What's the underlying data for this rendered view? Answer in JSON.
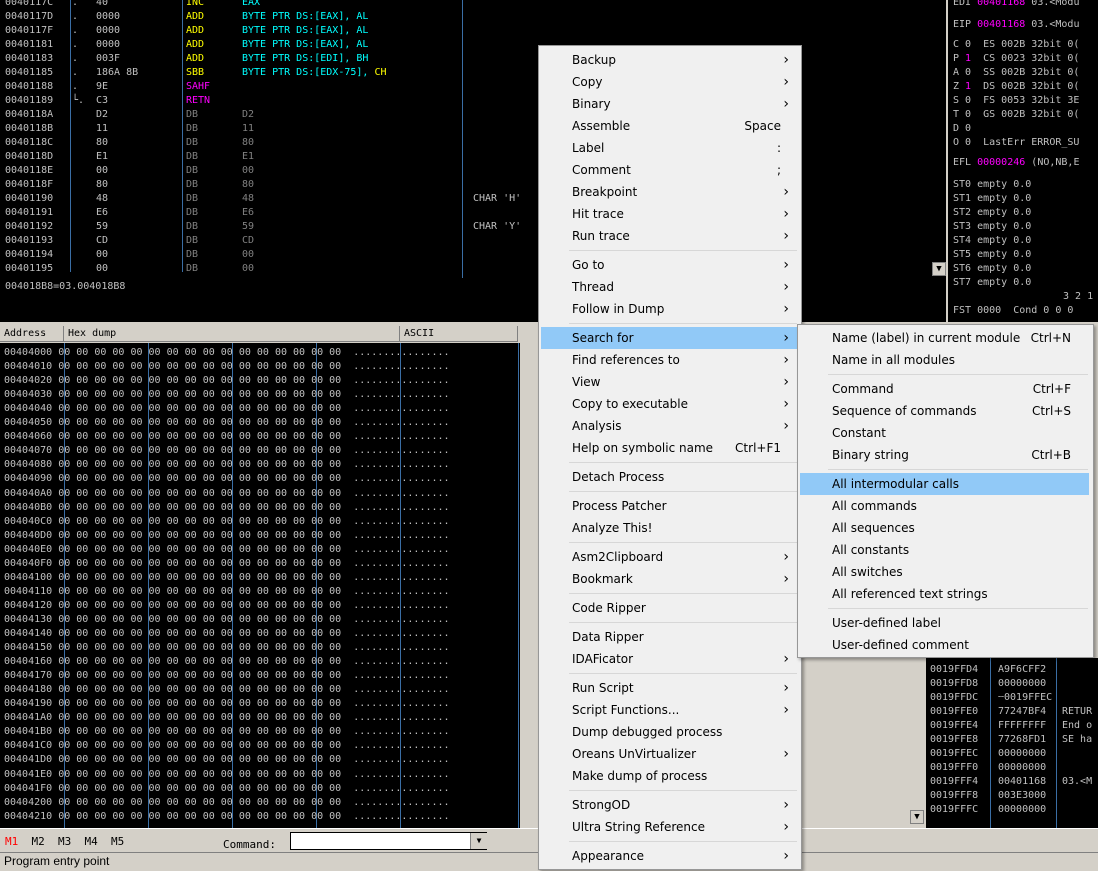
{
  "disasm": {
    "rows": [
      {
        "addr": "0040117C",
        "mark": ".",
        "bytes": "40",
        "mn": "INC",
        "op": "EAX",
        "op2": "",
        "comment": ""
      },
      {
        "addr": "0040117D",
        "mark": ".",
        "bytes": "0000",
        "mn": "ADD",
        "op": "BYTE PTR DS:[EAX], AL",
        "op2": "",
        "comment": ""
      },
      {
        "addr": "0040117F",
        "mark": ".",
        "bytes": "0000",
        "mn": "ADD",
        "op": "BYTE PTR DS:[EAX], AL",
        "op2": "",
        "comment": ""
      },
      {
        "addr": "00401181",
        "mark": ".",
        "bytes": "0000",
        "mn": "ADD",
        "op": "BYTE PTR DS:[EAX], AL",
        "op2": "",
        "comment": ""
      },
      {
        "addr": "00401183",
        "mark": ".",
        "bytes": "003F",
        "mn": "ADD",
        "op": "BYTE PTR DS:[EDI], BH",
        "op2": "",
        "comment": ""
      },
      {
        "addr": "00401185",
        "mark": ".",
        "bytes": "186A 8B",
        "mn": "SBB",
        "op": "BYTE PTR DS:[EDX-75], ",
        "op2": "CH",
        "comment": ""
      },
      {
        "addr": "00401188",
        "mark": ".",
        "bytes": "9E",
        "mn": "SAHF",
        "op": "",
        "op2": "",
        "comment": ""
      },
      {
        "addr": "00401189",
        "mark": "└.",
        "bytes": "C3",
        "mn": "RETN",
        "op": "",
        "op2": "",
        "comment": ""
      },
      {
        "addr": "0040118A",
        "mark": "",
        "bytes": "D2",
        "mn": "DB",
        "op": "D2",
        "op2": "",
        "comment": ""
      },
      {
        "addr": "0040118B",
        "mark": "",
        "bytes": "11",
        "mn": "DB",
        "op": "11",
        "op2": "",
        "comment": ""
      },
      {
        "addr": "0040118C",
        "mark": "",
        "bytes": "80",
        "mn": "DB",
        "op": "80",
        "op2": "",
        "comment": ""
      },
      {
        "addr": "0040118D",
        "mark": "",
        "bytes": "E1",
        "mn": "DB",
        "op": "E1",
        "op2": "",
        "comment": ""
      },
      {
        "addr": "0040118E",
        "mark": "",
        "bytes": "00",
        "mn": "DB",
        "op": "00",
        "op2": "",
        "comment": ""
      },
      {
        "addr": "0040118F",
        "mark": "",
        "bytes": "80",
        "mn": "DB",
        "op": "80",
        "op2": "",
        "comment": ""
      },
      {
        "addr": "00401190",
        "mark": "",
        "bytes": "48",
        "mn": "DB",
        "op": "48",
        "op2": "",
        "comment": "CHAR 'H'"
      },
      {
        "addr": "00401191",
        "mark": "",
        "bytes": "E6",
        "mn": "DB",
        "op": "E6",
        "op2": "",
        "comment": ""
      },
      {
        "addr": "00401192",
        "mark": "",
        "bytes": "59",
        "mn": "DB",
        "op": "59",
        "op2": "",
        "comment": "CHAR 'Y'"
      },
      {
        "addr": "00401193",
        "mark": "",
        "bytes": "CD",
        "mn": "DB",
        "op": "CD",
        "op2": "",
        "comment": ""
      },
      {
        "addr": "00401194",
        "mark": "",
        "bytes": "00",
        "mn": "DB",
        "op": "00",
        "op2": "",
        "comment": ""
      },
      {
        "addr": "00401195",
        "mark": "",
        "bytes": "00",
        "mn": "DB",
        "op": "00",
        "op2": "",
        "comment": ""
      }
    ],
    "info_line": "004018B8=03.004018B8"
  },
  "registers": {
    "rows": [
      {
        "name": "EDI",
        "value": "00401168",
        "info": "03.<Modu"
      },
      {
        "name": "EIP",
        "value": "00401168",
        "info": "03.<Modu"
      }
    ],
    "flags": [
      "C 0  ES 002B 32bit 0(",
      "P 1  CS 0023 32bit 0(",
      "A 0  SS 002B 32bit 0(",
      "Z 1  DS 002B 32bit 0(",
      "S 0  FS 0053 32bit 3E",
      "T 0  GS 002B 32bit 0(",
      "D 0",
      "O 0  LastErr ERROR_SU"
    ],
    "efl": {
      "name": "EFL",
      "value": "00000246",
      "info": "(NO,NB,E"
    },
    "fpu": [
      "ST0 empty 0.0",
      "ST1 empty 0.0",
      "ST2 empty 0.0",
      "ST3 empty 0.0",
      "ST4 empty 0.0",
      "ST5 empty 0.0",
      "ST6 empty 0.0",
      "ST7 empty 0.0"
    ],
    "fpu_bits": "3 2 1",
    "fst": "FST 0000  Cond 0 0 0"
  },
  "dump": {
    "header_address": "Address",
    "header_hex": "Hex dump",
    "header_ascii": "ASCII",
    "hex": "00 00 00 00 00 00 00 00 00 00 00 00 00 00 00 00",
    "ascii": "................",
    "addresses": [
      "00404000",
      "00404010",
      "00404020",
      "00404030",
      "00404040",
      "00404050",
      "00404060",
      "00404070",
      "00404080",
      "00404090",
      "004040A0",
      "004040B0",
      "004040C0",
      "004040D0",
      "004040E0",
      "004040F0",
      "00404100",
      "00404110",
      "00404120",
      "00404130",
      "00404140",
      "00404150",
      "00404160",
      "00404170",
      "00404180",
      "00404190",
      "004041A0",
      "004041B0",
      "004041C0",
      "004041D0",
      "004041E0",
      "004041F0",
      "00404200",
      "00404210"
    ]
  },
  "stack": {
    "rows": [
      {
        "addr": "0019FFD4",
        "val": "A9F6CFF2",
        "info": ""
      },
      {
        "addr": "0019FFD8",
        "val": "00000000",
        "info": ""
      },
      {
        "addr": "0019FFDC",
        "val": "┄0019FFEC",
        "info": ""
      },
      {
        "addr": "0019FFE0",
        "val": "77247BF4",
        "info": "RETUR"
      },
      {
        "addr": "0019FFE4",
        "val": "FFFFFFFF",
        "info": "End o"
      },
      {
        "addr": "0019FFE8",
        "val": "77268FD1",
        "info": "SE ha"
      },
      {
        "addr": "0019FFEC",
        "val": "00000000",
        "info": ""
      },
      {
        "addr": "0019FFF0",
        "val": "00000000",
        "info": ""
      },
      {
        "addr": "0019FFF4",
        "val": "00401168",
        "info": "03.<M"
      },
      {
        "addr": "0019FFF8",
        "val": "003E3000",
        "info": ""
      },
      {
        "addr": "0019FFFC",
        "val": "00000000",
        "info": ""
      }
    ]
  },
  "bottom": {
    "memtabs": [
      "M1",
      "M2",
      "M3",
      "M4",
      "M5"
    ],
    "command_label": "Command:",
    "command_value": ""
  },
  "status": {
    "text": "Program entry point"
  },
  "context_menu": {
    "items": [
      {
        "label": "Backup",
        "shortcut": "",
        "submenu": true
      },
      {
        "label": "Copy",
        "shortcut": "",
        "submenu": true
      },
      {
        "label": "Binary",
        "shortcut": "",
        "submenu": true
      },
      {
        "label": "Assemble",
        "shortcut": "Space",
        "submenu": false
      },
      {
        "label": "Label",
        "shortcut": ":",
        "submenu": false
      },
      {
        "label": "Comment",
        "shortcut": ";",
        "submenu": false
      },
      {
        "label": "Breakpoint",
        "shortcut": "",
        "submenu": true
      },
      {
        "label": "Hit trace",
        "shortcut": "",
        "submenu": true
      },
      {
        "label": "Run trace",
        "shortcut": "",
        "submenu": true
      },
      {
        "label": "Go to",
        "shortcut": "",
        "submenu": true
      },
      {
        "label": "Thread",
        "shortcut": "",
        "submenu": true
      },
      {
        "label": "Follow in Dump",
        "shortcut": "",
        "submenu": true
      },
      {
        "label": "Search for",
        "shortcut": "",
        "submenu": true
      },
      {
        "label": "Find references to",
        "shortcut": "",
        "submenu": true
      },
      {
        "label": "View",
        "shortcut": "",
        "submenu": true
      },
      {
        "label": "Copy to executable",
        "shortcut": "",
        "submenu": true
      },
      {
        "label": "Analysis",
        "shortcut": "",
        "submenu": true
      },
      {
        "label": "Help on symbolic name",
        "shortcut": "Ctrl+F1",
        "submenu": false
      },
      {
        "label": "Detach Process",
        "shortcut": "",
        "submenu": false
      },
      {
        "label": "Process Patcher",
        "shortcut": "",
        "submenu": false
      },
      {
        "label": "Analyze This!",
        "shortcut": "",
        "submenu": false
      },
      {
        "label": "Asm2Clipboard",
        "shortcut": "",
        "submenu": true
      },
      {
        "label": "Bookmark",
        "shortcut": "",
        "submenu": true
      },
      {
        "label": "Code Ripper",
        "shortcut": "",
        "submenu": false
      },
      {
        "label": "Data Ripper",
        "shortcut": "",
        "submenu": false
      },
      {
        "label": "IDAFicator",
        "shortcut": "",
        "submenu": true
      },
      {
        "label": "Run Script",
        "shortcut": "",
        "submenu": true
      },
      {
        "label": "Script Functions...",
        "shortcut": "",
        "submenu": true
      },
      {
        "label": "Dump debugged process",
        "shortcut": "",
        "submenu": false
      },
      {
        "label": "Oreans UnVirtualizer",
        "shortcut": "",
        "submenu": true
      },
      {
        "label": "Make dump of process",
        "shortcut": "",
        "submenu": false
      },
      {
        "label": "StrongOD",
        "shortcut": "",
        "submenu": true
      },
      {
        "label": "Ultra String Reference",
        "shortcut": "",
        "submenu": true
      },
      {
        "label": "Appearance",
        "shortcut": "",
        "submenu": true
      }
    ]
  },
  "search_submenu": {
    "items": [
      {
        "label": "Name (label) in current module",
        "shortcut": "Ctrl+N"
      },
      {
        "label": "Name in all modules",
        "shortcut": ""
      },
      {
        "label": "Command",
        "shortcut": "Ctrl+F"
      },
      {
        "label": "Sequence of commands",
        "shortcut": "Ctrl+S"
      },
      {
        "label": "Constant",
        "shortcut": ""
      },
      {
        "label": "Binary string",
        "shortcut": "Ctrl+B"
      },
      {
        "label": "All intermodular calls",
        "shortcut": ""
      },
      {
        "label": "All commands",
        "shortcut": ""
      },
      {
        "label": "All sequences",
        "shortcut": ""
      },
      {
        "label": "All constants",
        "shortcut": ""
      },
      {
        "label": "All switches",
        "shortcut": ""
      },
      {
        "label": "All referenced text strings",
        "shortcut": ""
      },
      {
        "label": "User-defined label",
        "shortcut": ""
      },
      {
        "label": "User-defined comment",
        "shortcut": ""
      }
    ]
  }
}
